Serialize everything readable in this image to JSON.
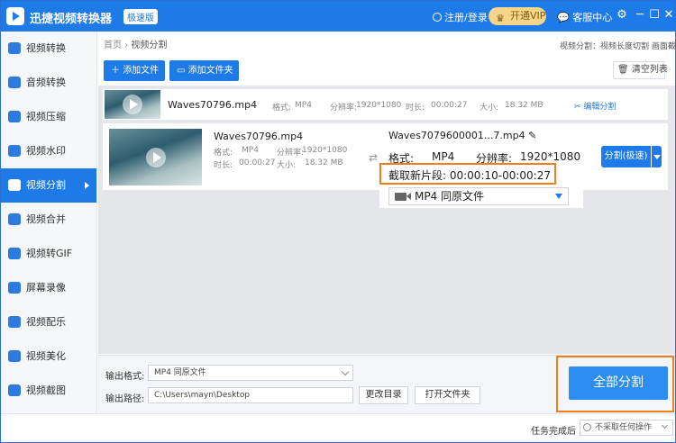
{
  "app": {
    "title": "迅捷视频转换器",
    "edition": "极速版",
    "login": "注册/登录",
    "vip": "开通VIP",
    "service": "客服中心",
    "controls": {
      "minimize": "─",
      "maximize": "☐",
      "close": "✕",
      "settings": "⚙"
    }
  },
  "sidebar": {
    "items": [
      {
        "label": "视频转换",
        "icon": "video-convert-icon"
      },
      {
        "label": "音频转换",
        "icon": "audio-convert-icon"
      },
      {
        "label": "视频压缩",
        "icon": "compress-icon"
      },
      {
        "label": "视频水印",
        "icon": "watermark-icon"
      },
      {
        "label": "视频分割",
        "icon": "split-icon",
        "active": true
      },
      {
        "label": "视频合并",
        "icon": "merge-icon"
      },
      {
        "label": "视频转GIF",
        "icon": "gif-icon"
      },
      {
        "label": "屏幕录像",
        "icon": "screen-record-icon"
      },
      {
        "label": "视频配乐",
        "icon": "music-icon"
      },
      {
        "label": "视频美化",
        "icon": "beautify-icon"
      },
      {
        "label": "视频截图",
        "icon": "screenshot-icon"
      }
    ]
  },
  "breadcrumb": {
    "home": "首页",
    "sep": "›",
    "current": "视频分割",
    "right": "视频分割：视频长度切割 画面截剪"
  },
  "toolbar": {
    "add_file": "添加文件",
    "add_folder": "添加文件夹",
    "clear_list": "清空列表"
  },
  "file_rows": [
    {
      "name": "Waves70796.mp4",
      "format_label": "格式:",
      "format": "MP4",
      "res_label": "分辨率:",
      "resolution": "1920*1080",
      "dur_label": "时长:",
      "duration": "00:00:27",
      "size_label": "大小:",
      "size": "18.32 MB",
      "edit_split": "编辑分割"
    },
    {
      "name": "Waves70796.mp4",
      "format_label": "格式:",
      "format": "MP4",
      "res_label": "分辨率:",
      "resolution": "1920*1080",
      "dur_label": "时长:",
      "duration": "00:00:27",
      "size_label": "大小:",
      "size": "18.32 MB",
      "output": {
        "name": "Waves7079600001...7.mp4",
        "format_label": "格式:",
        "format": "MP4",
        "res_label": "分辨率:",
        "resolution": "1920*1080",
        "segment": "截取新片段: 00:00:10-00:00:27",
        "format_select": "MP4   同原文件"
      },
      "split_button": "分割(极速)"
    }
  ],
  "bottom": {
    "output_format_label": "输出格式:",
    "output_format_value": "MP4   同原文件",
    "output_path_label": "输出路径:",
    "output_path_value": "C:\\Users\\mayn\\Desktop",
    "change_dir": "更改目录",
    "open_folder": "打开文件夹",
    "split_all": "全部分割"
  },
  "status": {
    "task_done_label": "任务完成后",
    "task_done_value": "不采取任何操作"
  },
  "colors": {
    "primary": "#1e7ae6",
    "highlight": "#ef7f1a",
    "vip": "#f4d58c"
  }
}
